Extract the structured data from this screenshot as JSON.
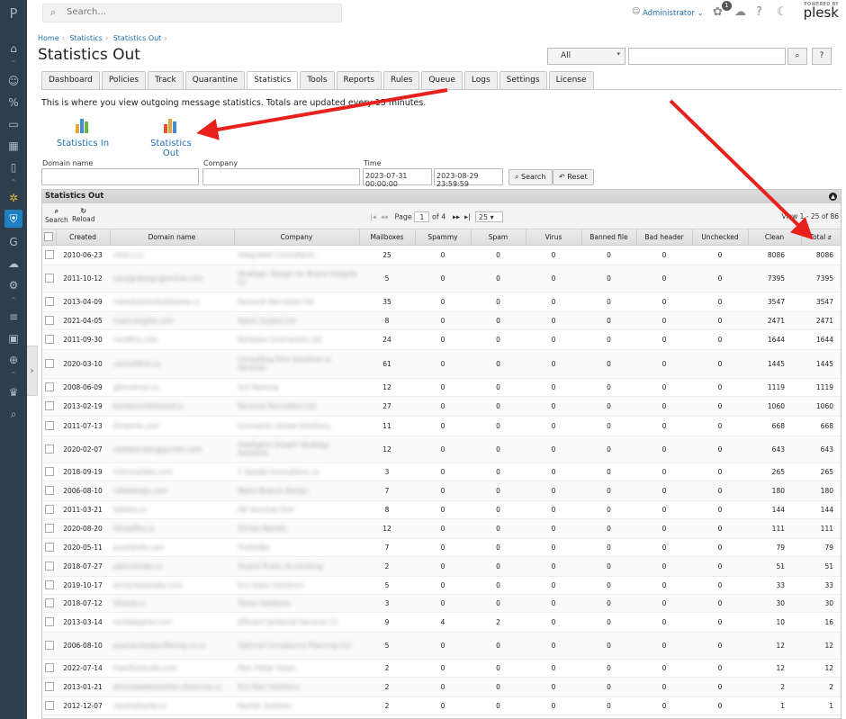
{
  "sidebar": {
    "logo": "P"
  },
  "topbar": {
    "search_placeholder": "Search...",
    "user": "Administrator",
    "notif_count": "1",
    "plesk_powered": "POWERED BY",
    "plesk_name": "plesk"
  },
  "breadcrumb": [
    "Home",
    "Statistics",
    "Statistics Out"
  ],
  "page_title": "Statistics Out",
  "filter": {
    "select_value": "All",
    "search_btn": "⌕",
    "help_btn": "?"
  },
  "tabs": [
    "Dashboard",
    "Policies",
    "Track",
    "Quarantine",
    "Statistics",
    "Tools",
    "Reports",
    "Rules",
    "Queue",
    "Logs",
    "Settings",
    "License"
  ],
  "active_tab": "Statistics",
  "intro": "This is where you view outgoing message statistics. Totals are updated every 15 minutes.",
  "big_buttons": [
    {
      "label": "Statistics In"
    },
    {
      "label": "Statistics Out"
    }
  ],
  "filters": {
    "domain_label": "Domain name",
    "company_label": "Company",
    "time_label": "Time",
    "time_from": "2023-07-31 00:00:00",
    "time_to": "2023-08-29 23:59:59",
    "search_btn": "Search",
    "reset_btn": "Reset"
  },
  "grid": {
    "title": "Statistics Out",
    "search": "Search",
    "reload": "Reload",
    "page_label": "Page",
    "page": "1",
    "of": "of 4",
    "per_page": "25",
    "view_info": "View 1 - 25 of 86"
  },
  "columns": [
    "Created",
    "Domain name",
    "Company",
    "Mailboxes",
    "Spammy",
    "Spam",
    "Virus",
    "Banned file",
    "Bad header",
    "Unchecked",
    "Clean",
    "Total"
  ],
  "rows": [
    {
      "created": "2010-06-23",
      "domain": "clnd.u.cz",
      "company": "Integrated Consultants",
      "mailboxes": "25",
      "spammy": "0",
      "spam": "0",
      "virus": "0",
      "banned": "0",
      "badheader": "0",
      "unchecked": "0",
      "clean": "8086",
      "total": "8086"
    },
    {
      "created": "2011-10-12",
      "domain": "saralgrdesign@online.com",
      "company": "Strategic Design for Brand Integrity Co",
      "mailboxes": "5",
      "spammy": "0",
      "spam": "0",
      "virus": "0",
      "banned": "0",
      "badheader": "0",
      "unchecked": "0",
      "clean": "7395",
      "total": "7395"
    },
    {
      "created": "2013-04-09",
      "domain": "mensfashionbutikkene.cz",
      "company": "Personal Recruiters ltd",
      "mailboxes": "35",
      "spammy": "0",
      "spam": "0",
      "virus": "0",
      "banned": "0",
      "badheader": "0",
      "unchecked": "0",
      "clean": "3547",
      "total": "3547"
    },
    {
      "created": "2021-04-05",
      "domain": "tropicwaglab.com",
      "company": "Fabric Supply Ltd",
      "mailboxes": "8",
      "spammy": "0",
      "spam": "0",
      "virus": "0",
      "banned": "0",
      "badheader": "0",
      "unchecked": "0",
      "clean": "2471",
      "total": "2471"
    },
    {
      "created": "2011-09-30",
      "domain": "nordfinn.com",
      "company": "Nordiska Contractors Ltd",
      "mailboxes": "24",
      "spammy": "0",
      "spam": "0",
      "virus": "0",
      "banned": "0",
      "badheader": "0",
      "unchecked": "0",
      "clean": "1644",
      "total": "1644"
    },
    {
      "created": "2020-03-10",
      "domain": "consultfirm.cz",
      "company": "Consulting Firm Solutions & Services",
      "mailboxes": "61",
      "spammy": "0",
      "spam": "0",
      "virus": "0",
      "banned": "0",
      "badheader": "0",
      "unchecked": "0",
      "clean": "1445",
      "total": "1445"
    },
    {
      "created": "2008-06-09",
      "domain": "glimnemyr.cz",
      "company": "Sch Naming",
      "mailboxes": "12",
      "spammy": "0",
      "spam": "0",
      "virus": "0",
      "banned": "0",
      "badheader": "0",
      "unchecked": "0",
      "clean": "1119",
      "total": "1119"
    },
    {
      "created": "2013-02-19",
      "domain": "bambooclothestuf.cz",
      "company": "Personal Recruiters Ltd",
      "mailboxes": "27",
      "spammy": "0",
      "spam": "0",
      "virus": "0",
      "banned": "0",
      "badheader": "0",
      "unchecked": "0",
      "clean": "1060",
      "total": "1060"
    },
    {
      "created": "2011-07-13",
      "domain": "limdome.com",
      "company": "Innovation Global Solutions",
      "mailboxes": "11",
      "spammy": "0",
      "spam": "0",
      "virus": "0",
      "banned": "0",
      "badheader": "0",
      "unchecked": "0",
      "clean": "668",
      "total": "668"
    },
    {
      "created": "2020-02-07",
      "domain": "netdata.labs@gunbin.com",
      "company": "Intelligent Growth Strategy Solutions",
      "mailboxes": "12",
      "spammy": "0",
      "spam": "0",
      "virus": "0",
      "banned": "0",
      "badheader": "0",
      "unchecked": "0",
      "clean": "643",
      "total": "643"
    },
    {
      "created": "2018-09-19",
      "domain": "mlmmarkets.com",
      "company": "C Spadal Innovations co",
      "mailboxes": "3",
      "spammy": "0",
      "spam": "0",
      "virus": "0",
      "banned": "0",
      "badheader": "0",
      "unchecked": "0",
      "clean": "265",
      "total": "265"
    },
    {
      "created": "2006-08-10",
      "domain": "netwebagn.com",
      "company": "Metro Branch Design",
      "mailboxes": "7",
      "spammy": "0",
      "spam": "0",
      "virus": "0",
      "banned": "0",
      "badheader": "0",
      "unchecked": "0",
      "clean": "180",
      "total": "180"
    },
    {
      "created": "2011-03-21",
      "domain": "Vidlata.cz",
      "company": "HR Services Firm",
      "mailboxes": "8",
      "spammy": "0",
      "spam": "0",
      "virus": "0",
      "banned": "0",
      "badheader": "0",
      "unchecked": "0",
      "clean": "144",
      "total": "144"
    },
    {
      "created": "2020-08-20",
      "domain": "Stickefire.cz",
      "company": "Sticker Barrels",
      "mailboxes": "12",
      "spammy": "0",
      "spam": "0",
      "virus": "0",
      "banned": "0",
      "badheader": "0",
      "unchecked": "0",
      "clean": "111",
      "total": "111"
    },
    {
      "created": "2020-05-11",
      "domain": "purpleinfo.com",
      "company": "TrulinkBiz",
      "mailboxes": "7",
      "spammy": "0",
      "spam": "0",
      "virus": "0",
      "banned": "0",
      "badheader": "0",
      "unchecked": "0",
      "clean": "79",
      "total": "79"
    },
    {
      "created": "2018-07-27",
      "domain": "pblondvider.cz",
      "company": "Pinpint Public Accounting",
      "mailboxes": "2",
      "spammy": "0",
      "spam": "0",
      "virus": "0",
      "banned": "0",
      "badheader": "0",
      "unchecked": "0",
      "clean": "51",
      "total": "51"
    },
    {
      "created": "2019-10-17",
      "domain": "emilyrealestate.com",
      "company": "Eco Glass Solutions",
      "mailboxes": "5",
      "spammy": "0",
      "spam": "0",
      "virus": "0",
      "banned": "0",
      "badheader": "0",
      "unchecked": "0",
      "clean": "33",
      "total": "33"
    },
    {
      "created": "2018-07-12",
      "domain": "Vlsand.cz",
      "company": "Trinsa Solutions",
      "mailboxes": "3",
      "spammy": "0",
      "spam": "0",
      "virus": "0",
      "banned": "0",
      "badheader": "0",
      "unchecked": "0",
      "clean": "30",
      "total": "30"
    },
    {
      "created": "2013-03-14",
      "domain": "rentalaspirer.com",
      "company": "Efficient Janitorial Services Co",
      "mailboxes": "9",
      "spammy": "4",
      "spam": "2",
      "virus": "0",
      "banned": "0",
      "badheader": "0",
      "unchecked": "0",
      "clean": "10",
      "total": "16"
    },
    {
      "created": "2006-08-10",
      "domain": "pearlandsalesoffering.co.cz",
      "company": "Optimal Compliance Planning LLC",
      "mailboxes": "5",
      "spammy": "0",
      "spam": "0",
      "virus": "0",
      "banned": "0",
      "badheader": "0",
      "unchecked": "0",
      "clean": "12",
      "total": "12"
    },
    {
      "created": "2022-07-14",
      "domain": "heartfulstudio.com",
      "company": "Park Potter Hosts",
      "mailboxes": "2",
      "spammy": "0",
      "spam": "0",
      "virus": "0",
      "banned": "0",
      "badheader": "0",
      "unchecked": "0",
      "clean": "12",
      "total": "12"
    },
    {
      "created": "2013-01-21",
      "domain": "elmoodwebsolution.cbsecure.cz",
      "company": "Eco Rain Solutions",
      "mailboxes": "2",
      "spammy": "0",
      "spam": "0",
      "virus": "0",
      "banned": "0",
      "badheader": "0",
      "unchecked": "0",
      "clean": "2",
      "total": "2"
    },
    {
      "created": "2012-12-07",
      "domain": "rayelvekpstd.cz",
      "company": "Raytek Systems",
      "mailboxes": "2",
      "spammy": "0",
      "spam": "0",
      "virus": "0",
      "banned": "0",
      "badheader": "0",
      "unchecked": "0",
      "clean": "1",
      "total": "1"
    }
  ]
}
